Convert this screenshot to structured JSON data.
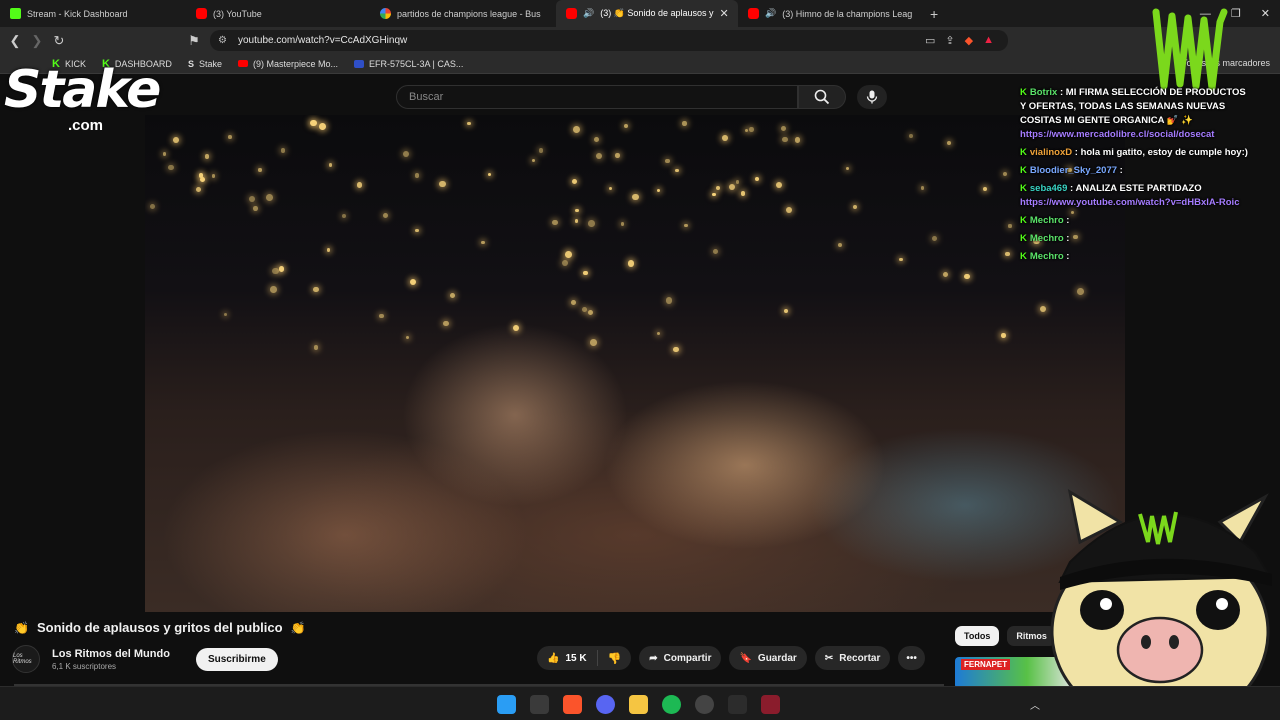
{
  "browser": {
    "tabs": [
      {
        "label": "Stream - Kick Dashboard",
        "icon": "kick-icon"
      },
      {
        "label": "(3) YouTube",
        "icon": "youtube-icon"
      },
      {
        "label": "partidos de champions league - Bus",
        "icon": "google-icon"
      },
      {
        "label": "(3) 👏 Sonido de aplausos y",
        "icon": "youtube-icon",
        "active": true
      },
      {
        "label": "(3) Himno de la champions Leag",
        "icon": "youtube-icon"
      }
    ],
    "url": "youtube.com/watch?v=CcAdXGHinqw",
    "bookmarks": [
      "KICK",
      "DASHBOARD",
      "Stake",
      "(9) Masterpiece Mo...",
      "EFR-575CL-3A | CAS..."
    ],
    "bookmarks_right": "Todos los marcadores"
  },
  "youtube": {
    "search_placeholder": "Buscar",
    "video_title": "Sonido de aplausos y gritos del publico",
    "title_emoji": "👏",
    "channel_name": "Los Ritmos del Mundo",
    "channel_avatar_text": "Los Ritmos",
    "channel_subs": "6,1 K suscriptores",
    "subscribe_label": "Suscribirme",
    "likes": "15 K",
    "share_label": "Compartir",
    "save_label": "Guardar",
    "clip_label": "Recortar",
    "more_label": "•••",
    "chips": [
      "Todos",
      "Ritmos"
    ],
    "suggested_thumb_text": "FERNAPET"
  },
  "chat": {
    "messages": [
      {
        "user": "Botrix",
        "sep": " : ",
        "text": "MI FIRMA SELECCIÓN DE PRODUCTOS Y OFERTAS, TODAS LAS SEMANAS NUEVAS COSITAS MI GENTE ORGANICA 💅 ✨",
        "link": "https://www.mercadolibre.cl/social/dosecat",
        "color": "green"
      },
      {
        "user": "vialinoxD",
        "sep": " : ",
        "text": "hola mi gatito, estoy de cumple hoy:)",
        "link": "",
        "color": "orange"
      },
      {
        "user": "Bloodier_Sky_2077",
        "sep": " : ",
        "text": "",
        "link": "",
        "color": "blue"
      },
      {
        "user": "seba469",
        "sep": " : ",
        "text": "ANALIZA ESTE PARTIDAZO",
        "link": "https://www.youtube.com/watch?v=dHBxlA-Roic",
        "color": "teal"
      },
      {
        "user": "Mechro",
        "sep": " : ",
        "text": "",
        "link": "",
        "color": "green"
      },
      {
        "user": "Mechro",
        "sep": " : ",
        "text": "",
        "link": "",
        "color": "green"
      },
      {
        "user": "Mechro",
        "sep": " : ",
        "text": "",
        "link": "",
        "color": "green"
      }
    ]
  },
  "overlay": {
    "stake_logo": "Stake",
    "stake_suffix": ".com"
  },
  "colors": {
    "kick_green": "#53fc18",
    "youtube_red": "#ff0000",
    "link_purple": "#a57cff"
  }
}
